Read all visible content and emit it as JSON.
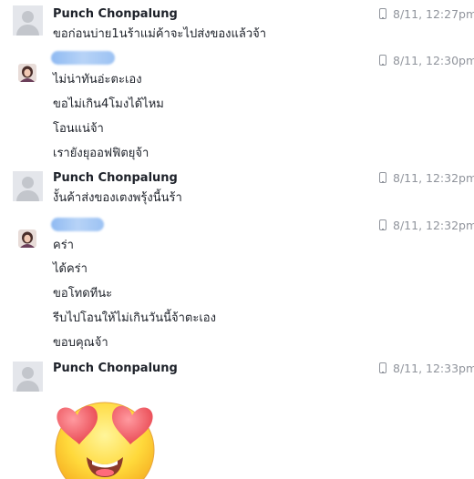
{
  "messages": [
    {
      "sender": "Punch Chonpalung",
      "time": "8/11, 12:27pm",
      "lines": [
        "ขอก่อนบ่าย1นร้าแม่ค้าจะไปส่งของแล้วจ้า"
      ]
    },
    {
      "sender": "",
      "time": "8/11, 12:30pm",
      "lines": [
        "ไม่น่าทันอ่ะตะเอง",
        "ขอไม่เกิน4โมงได้ไหม",
        "โอนแน่จ้า",
        "เรายังยุออฟฟิตยุจ้า"
      ]
    },
    {
      "sender": "Punch Chonpalung",
      "time": "8/11, 12:32pm",
      "lines": [
        "งั้นค้าส่งของเตงพรุ้งนี้นร้า"
      ]
    },
    {
      "sender": "",
      "time": "8/11, 12:32pm",
      "lines": [
        "คร่า",
        "ได้คร่า",
        "ขอโทดทีนะ",
        "รีบไปโอนให้ไม่เกินวันนี้จ้าตะเอง",
        "ขอบคุณจ้า"
      ]
    },
    {
      "sender": "Punch Chonpalung",
      "time": "8/11, 12:33pm",
      "lines": [],
      "sticker": "heart-eyes-emoji-icon"
    }
  ]
}
